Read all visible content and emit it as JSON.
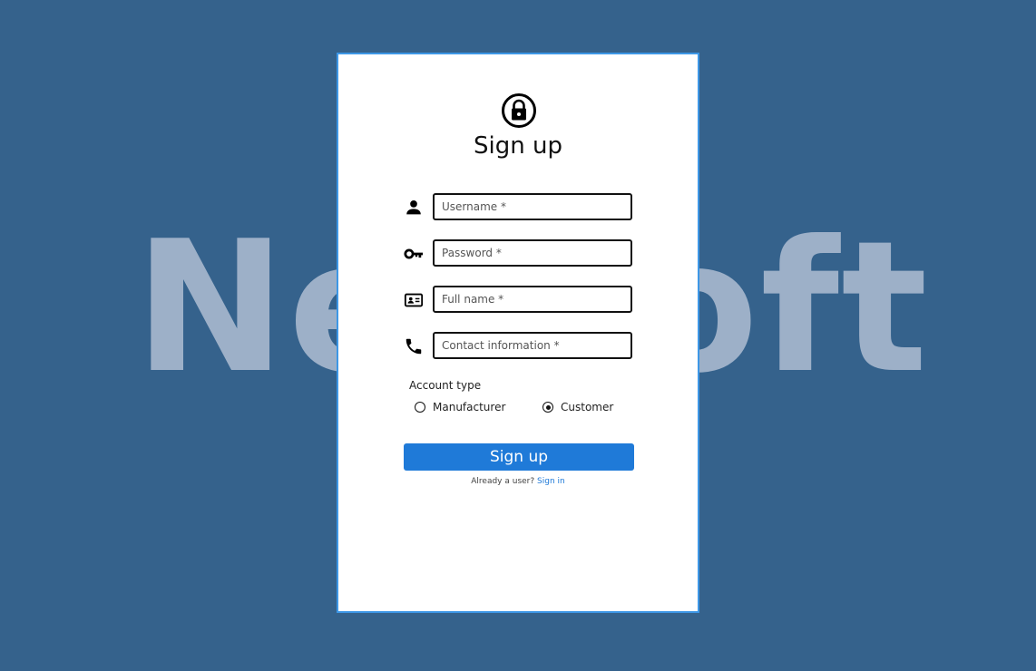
{
  "background": {
    "brand_text": "NetSoft",
    "color": "#35628c",
    "text_color": "#9db0c8"
  },
  "card": {
    "border_color": "#3d97e6"
  },
  "header": {
    "icon": "lock-icon",
    "title": "Sign up"
  },
  "fields": [
    {
      "icon": "person-icon",
      "placeholder": "Username *"
    },
    {
      "icon": "key-icon",
      "placeholder": "Password *"
    },
    {
      "icon": "id-card-icon",
      "placeholder": "Full name *"
    },
    {
      "icon": "phone-icon",
      "placeholder": "Contact information *"
    }
  ],
  "account_type": {
    "label": "Account type",
    "options": [
      {
        "label": "Manufacturer",
        "selected": false
      },
      {
        "label": "Customer",
        "selected": true
      }
    ]
  },
  "submit": {
    "label": "Sign up",
    "color": "#1f7ad8"
  },
  "footer": {
    "prompt": "Already a user?",
    "link": "Sign in"
  }
}
